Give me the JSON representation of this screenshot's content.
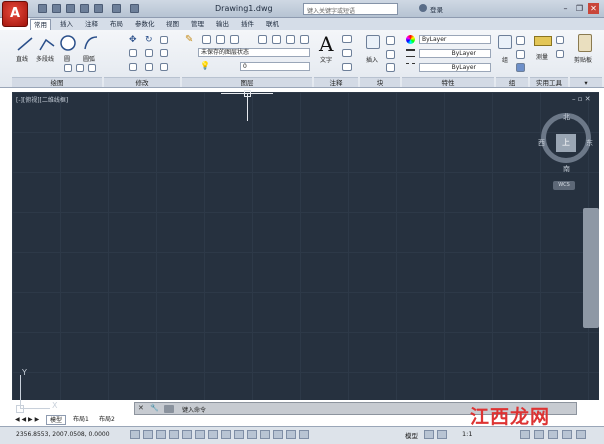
{
  "title_bar": {
    "document_title": "Drawing1.dwg",
    "search_placeholder": "键入关键字或短语",
    "login_label": "登录"
  },
  "ribbon_tabs": [
    "常用",
    "插入",
    "注释",
    "布局",
    "参数化",
    "视图",
    "管理",
    "输出",
    "插件",
    "联机"
  ],
  "active_tab_index": 0,
  "ribbon": {
    "draw": {
      "line": "直线",
      "polyline": "多段线",
      "circle": "圆",
      "arc": "圆弧",
      "panel": "绘图"
    },
    "modify": {
      "panel": "修改"
    },
    "layers": {
      "state": "未保存的图层状态",
      "current": "0",
      "panel": "图层"
    },
    "annotation": {
      "text": "文字",
      "panel": "注释"
    },
    "block": {
      "insert": "插入",
      "panel": "块"
    },
    "properties": {
      "color": "ByLayer",
      "linetype": "ByLayer",
      "lineweight": "ByLayer",
      "panel": "特性"
    },
    "groups": {
      "label": "组",
      "panel": "组"
    },
    "utilities": {
      "measure": "测量",
      "panel": "实用工具"
    },
    "clipboard": {
      "paste": "剪贴板"
    }
  },
  "viewport": {
    "label": "[-][俯视][二维线框]",
    "viewcube": {
      "north": "北",
      "south": "南",
      "east": "东",
      "west": "西",
      "face": "上",
      "wcs": "WCS"
    },
    "ucs_y": "Y",
    "ucs_x": "X"
  },
  "command_line": {
    "prompt": "键入命令"
  },
  "layout_tabs": [
    "模型",
    "布局1",
    "布局2"
  ],
  "status_bar": {
    "coordinates": "2356.8553, 2007.0508, 0.0000",
    "model_label": "模型",
    "scale": "1:1"
  },
  "watermark": "江西龙网",
  "colors": {
    "canvas": "#26313f",
    "accent": "#c0281e"
  }
}
